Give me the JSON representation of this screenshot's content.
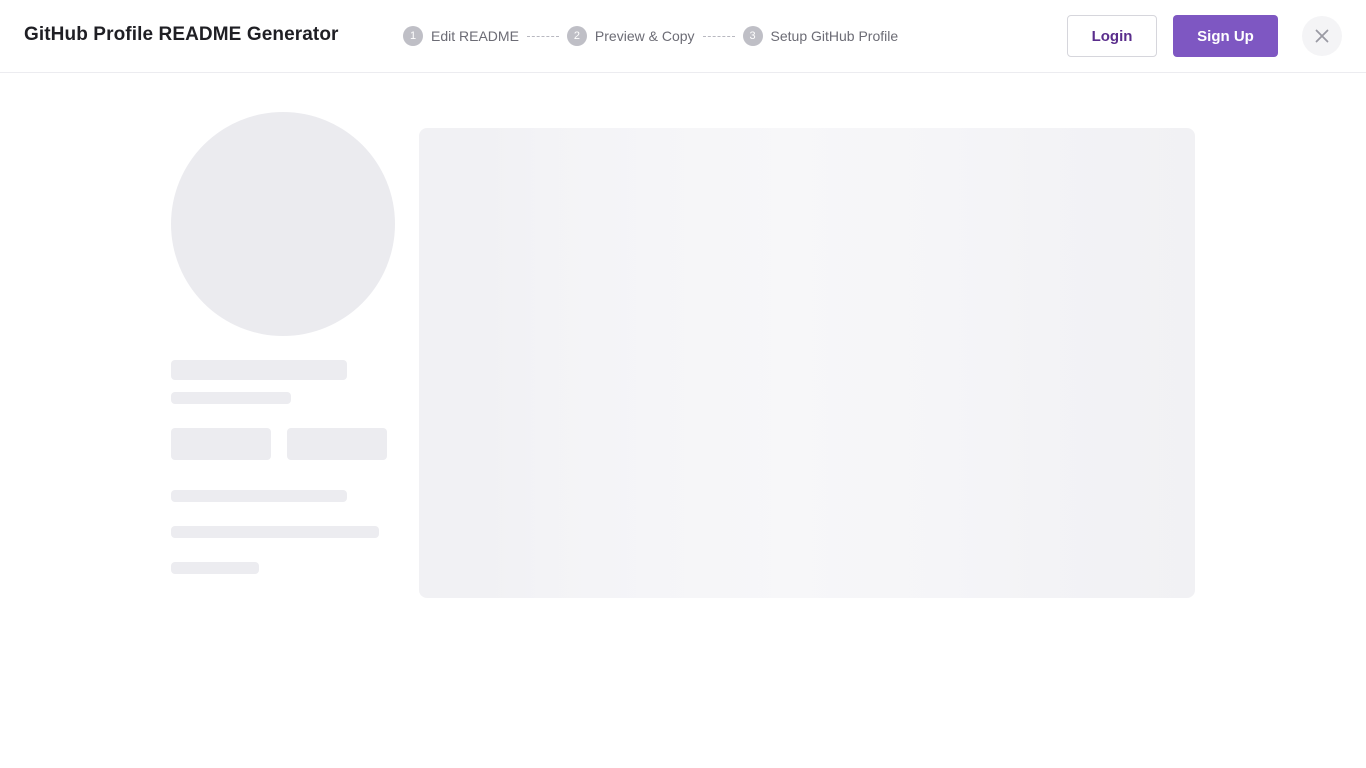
{
  "app": {
    "title": "GitHub Profile README Generator"
  },
  "steps": [
    {
      "number": "1",
      "label": "Edit README"
    },
    {
      "number": "2",
      "label": "Preview & Copy"
    },
    {
      "number": "3",
      "label": "Setup GitHub Profile"
    }
  ],
  "auth": {
    "login_label": "Login",
    "signup_label": "Sign Up"
  },
  "icons": {
    "close": "close-icon"
  },
  "colors": {
    "brand_primary": "#7e57c2",
    "login_text": "#5a2d8c",
    "skeleton": "#ececf0",
    "step_badge": "#bfbfc6"
  },
  "state": {
    "loading": true
  }
}
